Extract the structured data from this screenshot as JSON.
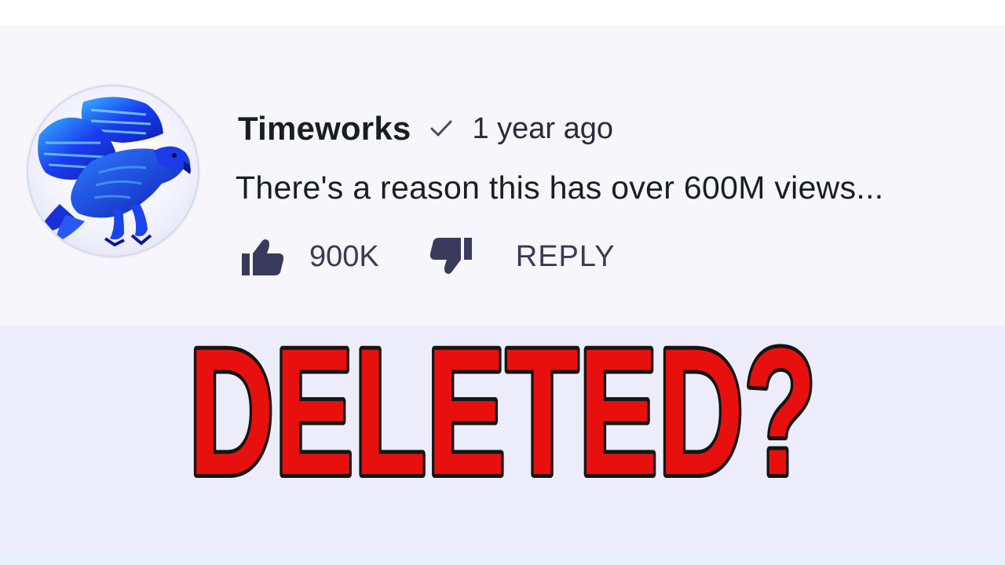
{
  "comment": {
    "author": "Timeworks",
    "verified_icon": "checkmark-icon",
    "timestamp": "1 year ago",
    "text": "There's a reason this has over 600M views...",
    "likes": "900K",
    "reply_label": "REPLY",
    "avatar_icon": "eagle-avatar"
  },
  "headline": {
    "text": "DELETED?",
    "fill_color": "#e8100e",
    "outline_color": "#151515"
  },
  "colors": {
    "card_background": "#f6f6fb",
    "band_background": "#ececfb",
    "icon_color": "#3a3a5c",
    "avatar_blue": "#1a3cf0"
  }
}
